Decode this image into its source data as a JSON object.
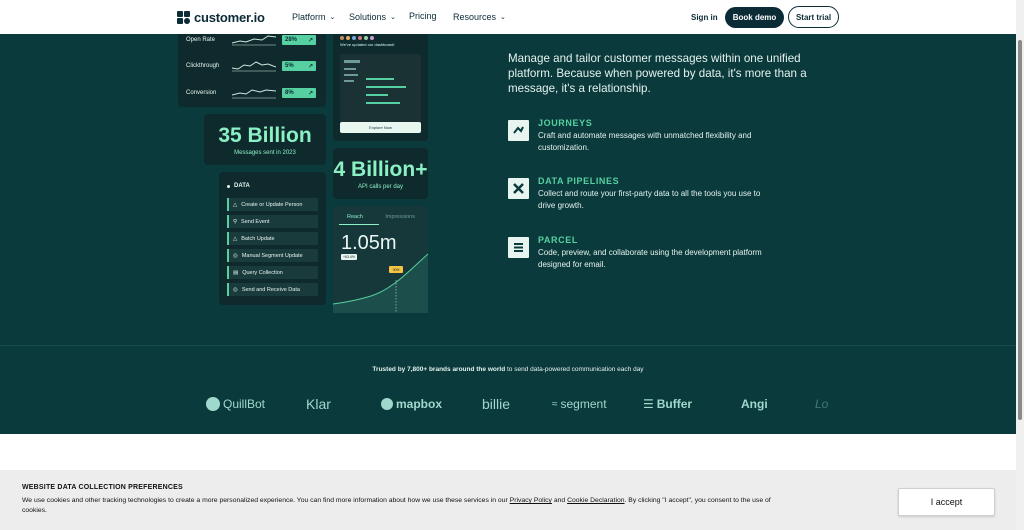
{
  "nav": {
    "logo_text": "customer.io",
    "items": [
      {
        "label": "Platform",
        "has_menu": true
      },
      {
        "label": "Solutions",
        "has_menu": true
      },
      {
        "label": "Pricing",
        "has_menu": false
      },
      {
        "label": "Resources",
        "has_menu": true
      }
    ],
    "sign_in": "Sign in",
    "book_demo": "Book demo",
    "start_trial": "Start trial"
  },
  "dashboard": {
    "metrics": [
      {
        "label": "Open Rate",
        "value": "28%"
      },
      {
        "label": "Clickthrough",
        "value": "5%"
      },
      {
        "label": "Conversion",
        "value": "8%"
      }
    ],
    "phone": {
      "updated_text": "We've updated our dashboard!",
      "button_label": "Explore Now"
    },
    "messages_stat": {
      "number": "35 Billion",
      "caption": "Messages sent in 2023"
    },
    "api_stat": {
      "number": "4 Billion+",
      "caption": "API calls per day"
    },
    "data_panel": {
      "heading": "DATA",
      "items": [
        "Create or Update Person",
        "Send Event",
        "Batch Update",
        "Manual Segment Update",
        "Query Collection",
        "Send and Receive Data"
      ]
    },
    "reach": {
      "tab_active": "Reach",
      "tab_inactive": "Impressions",
      "value": "1.05m",
      "pill": "+63.4%",
      "tooltip": "30M"
    }
  },
  "hero": {
    "headline": "Manage and tailor customer messages within one unified platform. Because when powered by data, it's more than a message, it's a relationship."
  },
  "features": [
    {
      "title": "JOURNEYS",
      "description": "Craft and automate messages with unmatched flexibility and customization.",
      "icon": "journeys-icon"
    },
    {
      "title": "DATA PIPELINES",
      "description": "Collect and route your first-party data to all the tools you use to drive growth.",
      "icon": "pipelines-icon"
    },
    {
      "title": "PARCEL",
      "description": "Code, preview, and collaborate using the development platform designed for email.",
      "icon": "parcel-icon"
    }
  ],
  "trusted": {
    "bold": "Trusted by 7,800+ brands around the world",
    "rest": " to send data-powered communication each day"
  },
  "brands": [
    "QuillBot",
    "Klar",
    "mapbox",
    "billie",
    "segment",
    "Buffer",
    "Angi",
    "Lo"
  ],
  "cookie": {
    "title": "WEBSITE DATA COLLECTION PREFERENCES",
    "text_before": "We use cookies and other tracking technologies to create a more personalized experience. You can find more information about how we use these services in our ",
    "privacy_link": "Privacy Policy",
    "and": " and ",
    "cookie_link": "Cookie Declaration",
    "text_after": ". By clicking \"I accept\", you consent to the use of cookies.",
    "accept": "I accept"
  },
  "colors": {
    "background": "#0b3a3c",
    "accent": "#56d0a0",
    "stat": "#8cf0c5"
  }
}
